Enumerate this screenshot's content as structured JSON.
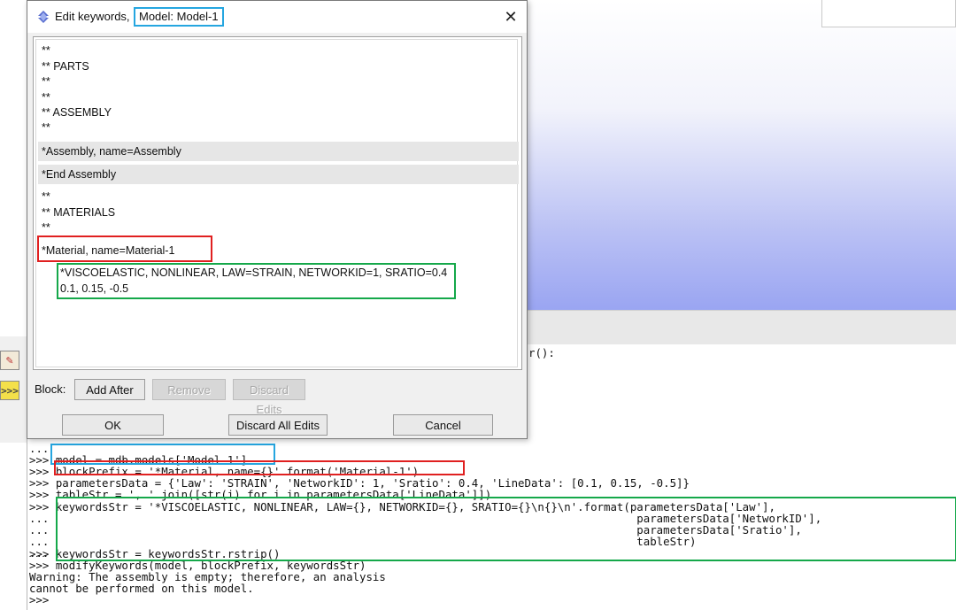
{
  "dialog": {
    "title_prefix": "Edit keywords,",
    "title_model": "Model: Model-1",
    "close_glyph": "✕",
    "keyword_lines": [
      "**",
      "** PARTS",
      "**",
      "**",
      "** ASSEMBLY",
      "**",
      "*Assembly, name=Assembly",
      "*End Assembly",
      "**",
      "** MATERIALS",
      "**",
      "*Material, name=Material-1",
      "*VISCOELASTIC, NONLINEAR, LAW=STRAIN, NETWORKID=1, SRATIO=0.4",
      "0.1, 0.15, -0.5"
    ],
    "block_label": "Block:",
    "buttons": {
      "add_after": "Add After",
      "remove": "Remove",
      "discard_edits": "Discard Edits",
      "ok": "OK",
      "discard_all": "Discard All Edits",
      "cancel": "Cancel"
    }
  },
  "console": {
    "partial_top": "r():",
    "lines": [
      "...",
      ">>> model = mdb.models['Model-1']",
      ">>> blockPrefix = '*Material, name={}'.format('Material-1')",
      ">>> parametersData = {'Law': 'STRAIN', 'NetworkID': 1, 'Sratio': 0.4, 'LineData': [0.1, 0.15, -0.5]}",
      ">>> tableStr = ', '.join([str(i) for i in parametersData['LineData']])",
      ">>> keywordsStr = '*VISCOELASTIC, NONLINEAR, LAW={}, NETWORKID={}, SRATIO={}\\n{}\\n'.format(parametersData['Law'],",
      "...                                                                                         parametersData['NetworkID'],",
      "...                                                                                         parametersData['Sratio'],",
      "...                                                                                         tableStr)",
      "...",
      ">>> keywordsStr = keywordsStr.rstrip()",
      ">>> modifyKeywords(model, blockPrefix, keywordsStr)",
      "Warning: The assembly is empty; therefore, an analysis",
      "cannot be performed on this model.",
      ">>>"
    ]
  },
  "toolbox": {
    "tool1_icon": "query-icon",
    "tool2_icon": "python-prompt-icon",
    "tool2_glyph": ">>>"
  },
  "colors": {
    "highlight_blue": "#25a6e0",
    "highlight_red": "#e02020",
    "highlight_green": "#15a84a"
  }
}
